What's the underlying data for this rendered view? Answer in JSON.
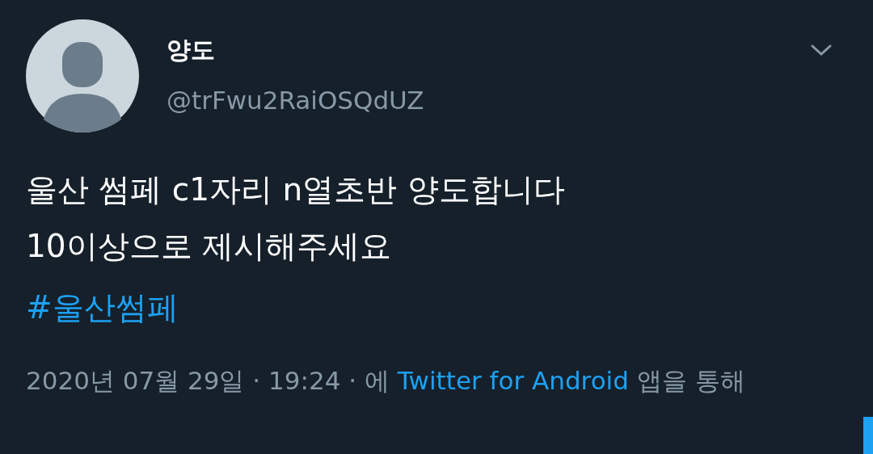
{
  "author": {
    "name": "양도",
    "handle": "@trFwu2RaiOSQdUZ"
  },
  "tweet": {
    "lines": [
      "울산 썸페 c1자리 n열초반 양도합니다",
      "10이상으로 제시해주세요"
    ],
    "hashtag": "#울산썸페"
  },
  "meta": {
    "prefix": "2020년 07월 29일 · 19:24 · 에",
    "source": "Twitter for Android",
    "suffix": "앱을 통해"
  }
}
